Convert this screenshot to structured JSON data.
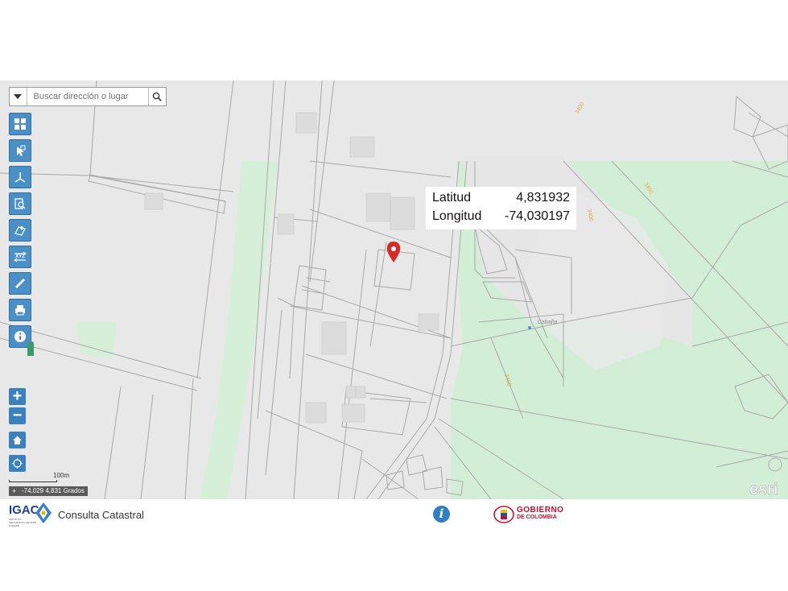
{
  "search": {
    "placeholder": "Buscar dirección o lugar"
  },
  "toolbar": {
    "tools": [
      "basemap-gallery",
      "identify",
      "coordinates",
      "search-parcel",
      "locate-point",
      "xyz-converter",
      "measure",
      "print",
      "info"
    ],
    "xyz_label": "XYZ"
  },
  "popup": {
    "lat_label": "Latitud",
    "lat_value": "4,831932",
    "lon_label": "Longitud",
    "lon_value": "-74,030197"
  },
  "map": {
    "scale_label": "100m",
    "coords_readout": "-74,029 4,831 Grados",
    "place_label": "Cabaña",
    "contour_label": "3400",
    "attribution": "esri"
  },
  "footer": {
    "igac_logo": "IGAC",
    "igac_sub": "INSTITUTO GEOGRÁFICO AGUSTÍN CODAZZI",
    "title": "Consulta Catastral",
    "gov_line1": "GOBIERNO",
    "gov_line2": "DE COLOMBIA"
  },
  "colors": {
    "accent": "#3b81bd",
    "marker": "#d62b2b",
    "green": "#cfead3",
    "gov_red": "#c8102e"
  }
}
